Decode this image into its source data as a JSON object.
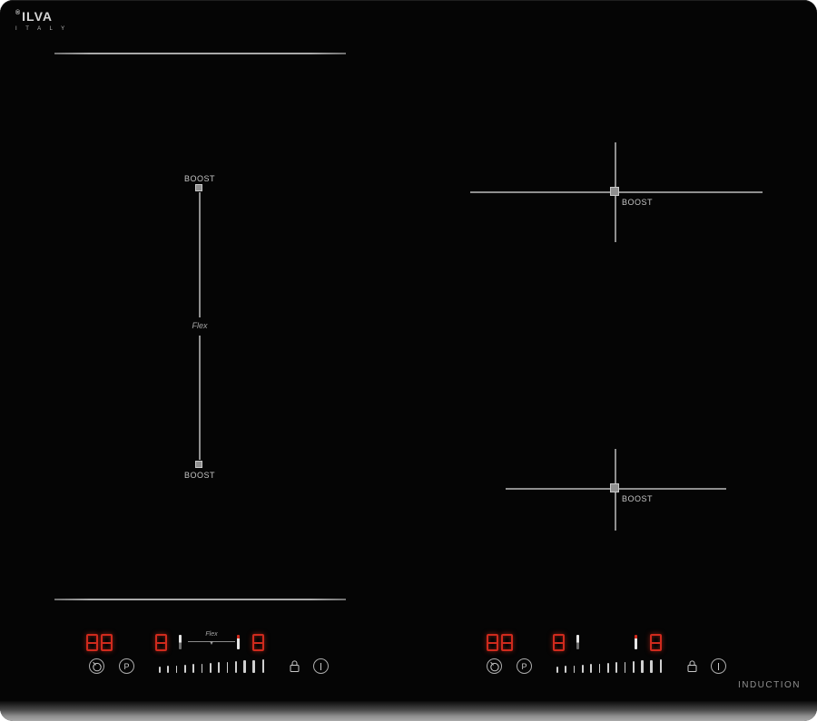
{
  "brand": {
    "registered": "®",
    "wordmark": "ILVA",
    "country": "I T A L Y"
  },
  "labels": {
    "boost": "BOOST",
    "flex": "Flex",
    "induction": "INDUCTION"
  },
  "colors": {
    "led_red": "#cf2a1d",
    "marking_gray": "#8f8f8f",
    "text_gray": "#c4c4c4"
  },
  "zones": {
    "flex_left": {
      "boost_top": "BOOST",
      "flex_label": "Flex",
      "boost_bottom": "BOOST"
    },
    "right_upper": {
      "boost": "BOOST"
    },
    "right_lower": {
      "boost": "BOOST"
    }
  },
  "panels": [
    {
      "timer_display": "88",
      "left_zone_level": "8",
      "right_zone_level": "8",
      "flex_label": "Flex",
      "program_key": "P",
      "slider_ticks": 13
    },
    {
      "timer_display": "88",
      "left_zone_level": "8",
      "right_zone_level": "8",
      "program_key": "P",
      "slider_ticks": 13
    }
  ],
  "footer": {
    "induction": "INDUCTION"
  }
}
